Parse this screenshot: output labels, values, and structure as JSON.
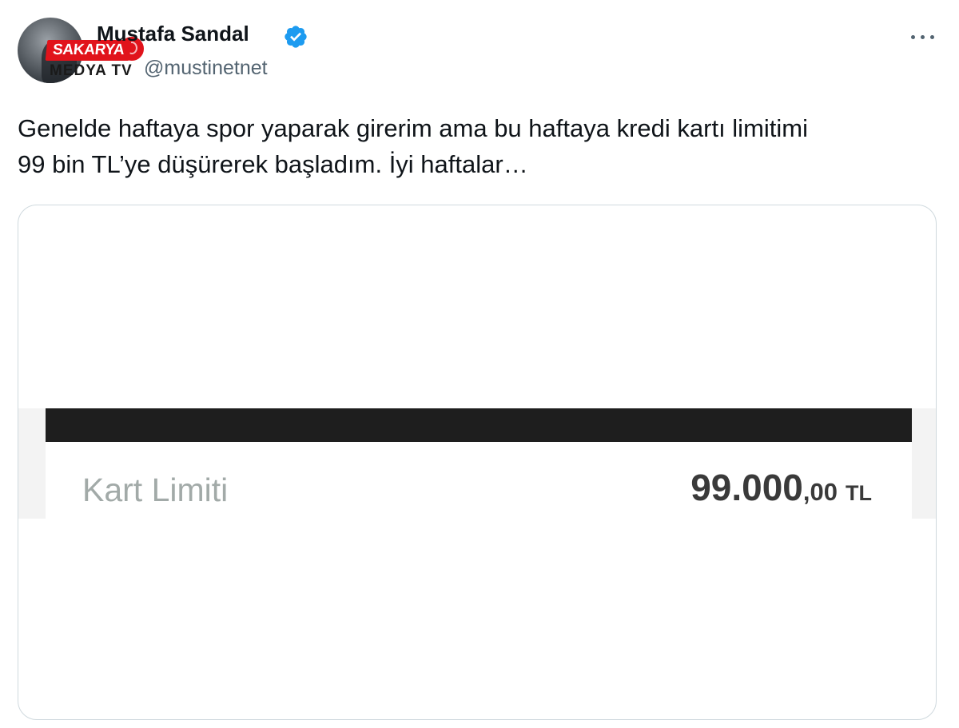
{
  "author": {
    "display_name": "Mustafa Sandal",
    "handle": "@mustinetnet",
    "verified": true
  },
  "watermark": {
    "brand": "SAKARYA",
    "sub": "MEDYA TV"
  },
  "tweet": {
    "text_line1": "Genelde haftaya spor yaparak girerim ama bu haftaya kredi kartı limitimi",
    "text_line2": "99 bin TL’ye düşürerek başladım. İyi haftalar…"
  },
  "media_screenshot": {
    "label": "Kart Limiti",
    "value_main": "99.000",
    "value_decimals": ",00",
    "currency": "TL"
  },
  "colors": {
    "verified_badge": "#1d9bf0",
    "watermark_red": "#e1131b",
    "handle_gray": "#536471"
  },
  "icons": {
    "verified": "verified-badge-icon",
    "more": "more-horizontal-icon"
  }
}
